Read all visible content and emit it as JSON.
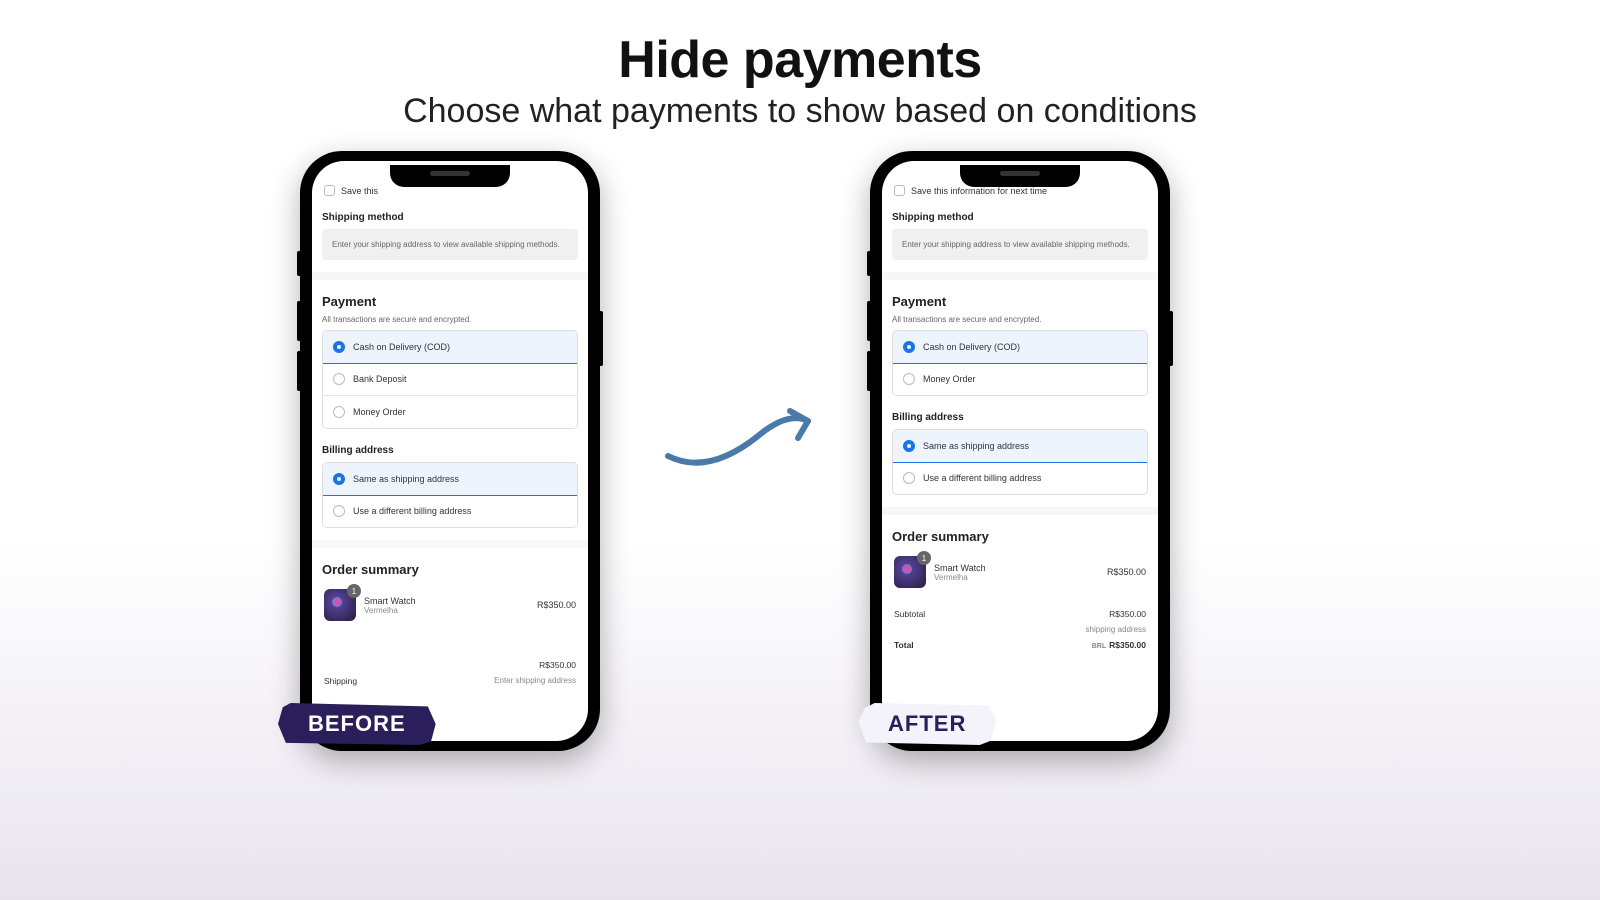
{
  "heading": {
    "title": "Hide payments",
    "subtitle": "Choose what payments to show based on conditions"
  },
  "before": {
    "save_label": "Save this",
    "shipping_title": "Shipping method",
    "shipping_hint": "Enter your shipping address to view available shipping methods.",
    "payment_title": "Payment",
    "payment_sub": "All transactions are secure and encrypted.",
    "options": [
      {
        "label": "Cash on Delivery (COD)",
        "selected": true
      },
      {
        "label": "Bank Deposit",
        "selected": false
      },
      {
        "label": "Money Order",
        "selected": false
      }
    ],
    "billing_title": "Billing address",
    "billing": [
      {
        "label": "Same as shipping address",
        "selected": true
      },
      {
        "label": "Use a different billing address",
        "selected": false
      }
    ],
    "order_title": "Order summary",
    "product": {
      "name": "Smart Watch",
      "variant": "Vermelha",
      "qty": "1",
      "price": "R$350.00"
    },
    "subtotal": {
      "label": "",
      "value": "R$350.00"
    },
    "shipping_row": {
      "label": "Shipping",
      "value": "Enter shipping address"
    }
  },
  "after": {
    "save_label": "Save this information for next time",
    "shipping_title": "Shipping method",
    "shipping_hint": "Enter your shipping address to view available shipping methods.",
    "payment_title": "Payment",
    "payment_sub": "All transactions are secure and encrypted.",
    "options": [
      {
        "label": "Cash on Delivery (COD)",
        "selected": true
      },
      {
        "label": "Money Order",
        "selected": false
      }
    ],
    "billing_title": "Billing address",
    "billing": [
      {
        "label": "Same as shipping address",
        "selected": true
      },
      {
        "label": "Use a different billing address",
        "selected": false
      }
    ],
    "order_title": "Order summary",
    "product": {
      "name": "Smart Watch",
      "variant": "Vermelha",
      "qty": "1",
      "price": "R$350.00"
    },
    "subtotal": {
      "label": "Subtotal",
      "value": "R$350.00"
    },
    "shipping_row": {
      "label": "",
      "value": "shipping address"
    },
    "total": {
      "label": "Total",
      "currency": "BRL",
      "value": "R$350.00"
    }
  },
  "labels": {
    "before": "BEFORE",
    "after": "AFTER"
  }
}
